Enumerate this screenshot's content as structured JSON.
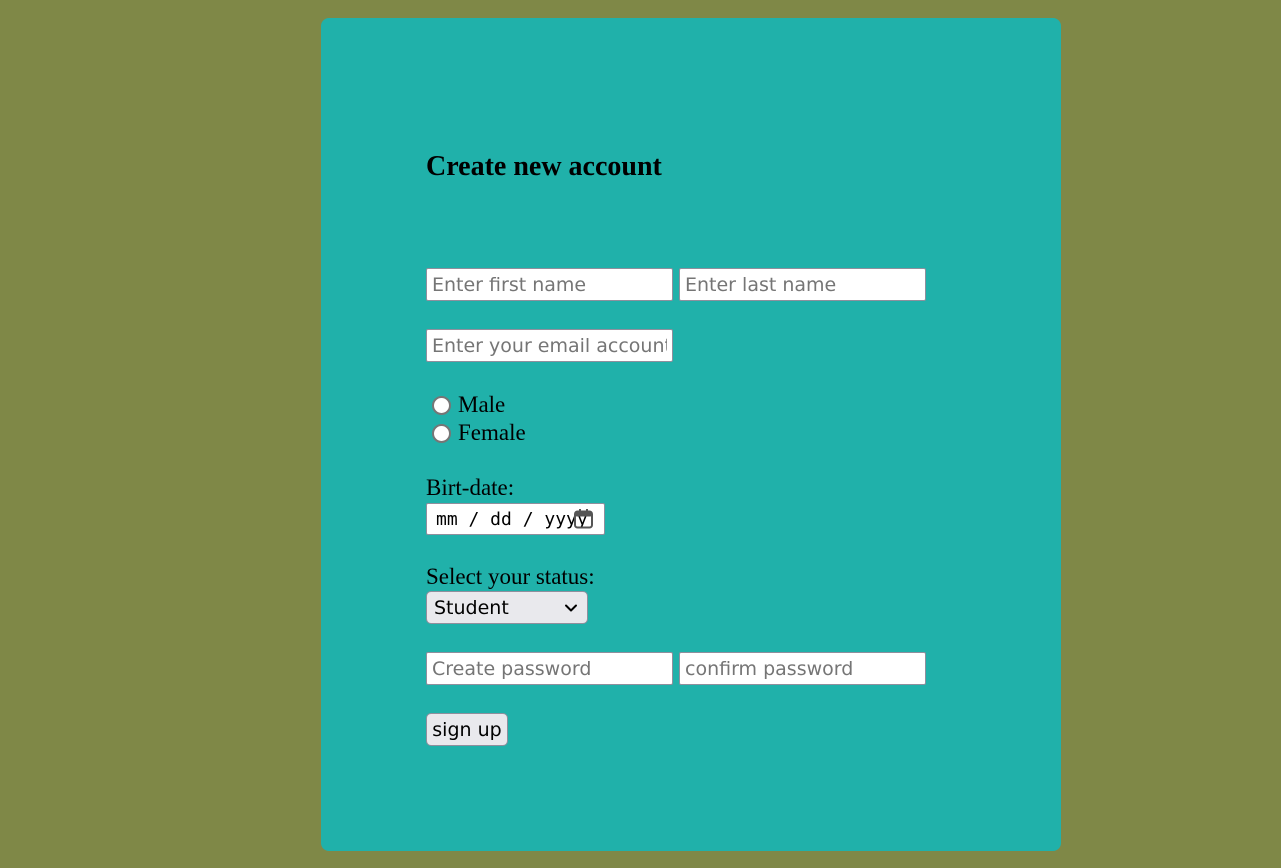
{
  "form": {
    "title": "Create new account",
    "first_name": {
      "placeholder": "Enter first name",
      "value": ""
    },
    "last_name": {
      "placeholder": "Enter last name",
      "value": ""
    },
    "email": {
      "placeholder": "Enter your email account",
      "value": ""
    },
    "gender_options": [
      {
        "label": "Male",
        "checked": false
      },
      {
        "label": "Female",
        "checked": false
      }
    ],
    "birthdate_label": "Birt-date:",
    "birthdate_value": "mm / dd / yyyy",
    "status_label": "Select your status:",
    "status_selected": "Student",
    "password": {
      "placeholder": "Create password",
      "value": ""
    },
    "confirm_password": {
      "placeholder": "confirm password",
      "value": ""
    },
    "submit_label": "sign up"
  },
  "icons": {
    "calendar": "calendar-icon",
    "select_arrow": "chevron-down-icon"
  },
  "colors": {
    "page_background": "#7f8847",
    "card_background": "#20b1aa",
    "button_background": "#e9e9ed",
    "input_border": "#8f8f9d"
  }
}
